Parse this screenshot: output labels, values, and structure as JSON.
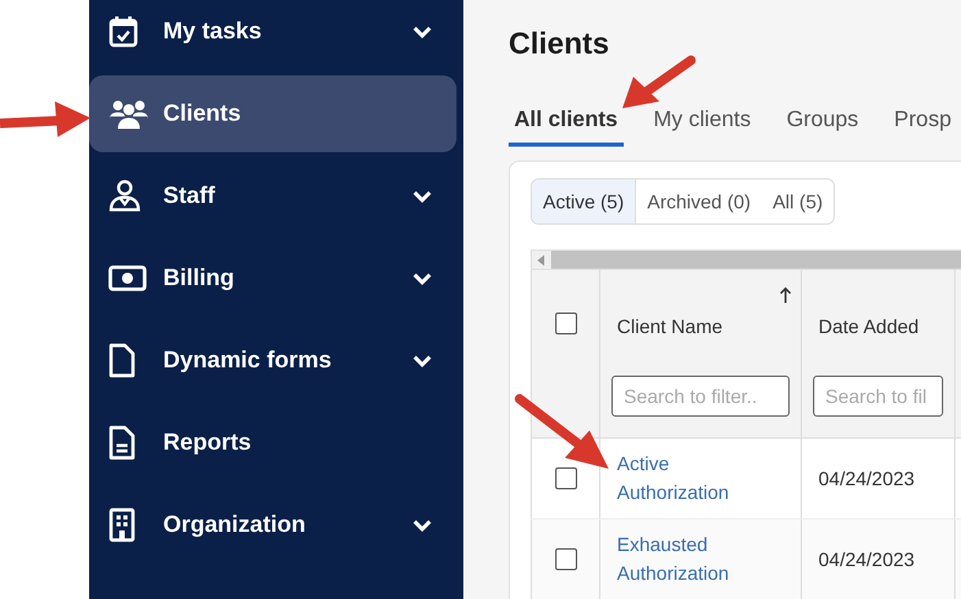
{
  "sidebar": {
    "items": [
      {
        "label": "My tasks",
        "expandable": true,
        "selected": false
      },
      {
        "label": "Clients",
        "expandable": false,
        "selected": true
      },
      {
        "label": "Staff",
        "expandable": true,
        "selected": false
      },
      {
        "label": "Billing",
        "expandable": true,
        "selected": false
      },
      {
        "label": "Dynamic forms",
        "expandable": true,
        "selected": false
      },
      {
        "label": "Reports",
        "expandable": false,
        "selected": false
      },
      {
        "label": "Organization",
        "expandable": true,
        "selected": false
      }
    ]
  },
  "page": {
    "title": "Clients"
  },
  "tabs": [
    {
      "label": "All clients",
      "selected": true
    },
    {
      "label": "My clients",
      "selected": false
    },
    {
      "label": "Groups",
      "selected": false
    },
    {
      "label": "Prosp",
      "selected": false
    }
  ],
  "status_filter": [
    {
      "label": "Active (5)",
      "selected": true
    },
    {
      "label": "Archived (0)",
      "selected": false
    },
    {
      "label": "All (5)",
      "selected": false
    }
  ],
  "table": {
    "select_all_checked": false,
    "columns": [
      {
        "label": "Client Name",
        "sorted_ascending": true,
        "filter_placeholder": "Search to filter.."
      },
      {
        "label": "Date Added",
        "sorted_ascending": false,
        "filter_placeholder": "Search to fil"
      }
    ],
    "rows": [
      {
        "checked": false,
        "client_name": "Active Authorization",
        "date_added": "04/24/2023"
      },
      {
        "checked": false,
        "client_name": "Exhausted Authorization",
        "date_added": "04/24/2023"
      }
    ]
  }
}
